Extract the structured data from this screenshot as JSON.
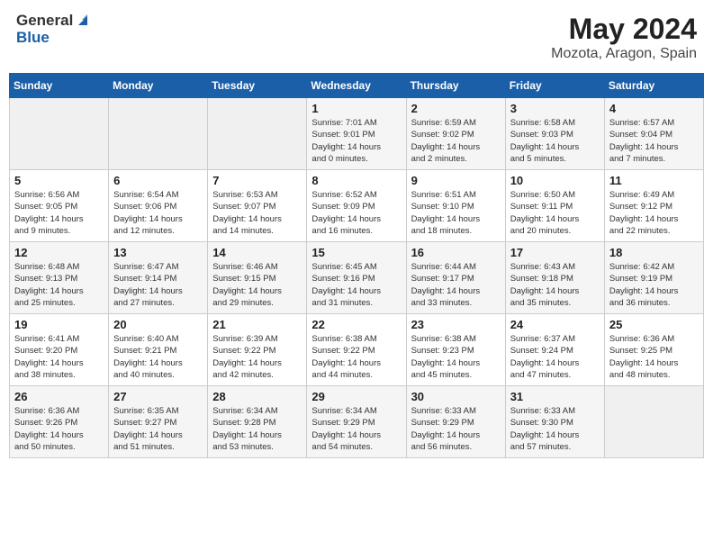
{
  "header": {
    "logo_general": "General",
    "logo_blue": "Blue",
    "month_year": "May 2024",
    "location": "Mozota, Aragon, Spain"
  },
  "days_of_week": [
    "Sunday",
    "Monday",
    "Tuesday",
    "Wednesday",
    "Thursday",
    "Friday",
    "Saturday"
  ],
  "weeks": [
    [
      {
        "day": "",
        "info": ""
      },
      {
        "day": "",
        "info": ""
      },
      {
        "day": "",
        "info": ""
      },
      {
        "day": "1",
        "info": "Sunrise: 7:01 AM\nSunset: 9:01 PM\nDaylight: 14 hours\nand 0 minutes."
      },
      {
        "day": "2",
        "info": "Sunrise: 6:59 AM\nSunset: 9:02 PM\nDaylight: 14 hours\nand 2 minutes."
      },
      {
        "day": "3",
        "info": "Sunrise: 6:58 AM\nSunset: 9:03 PM\nDaylight: 14 hours\nand 5 minutes."
      },
      {
        "day": "4",
        "info": "Sunrise: 6:57 AM\nSunset: 9:04 PM\nDaylight: 14 hours\nand 7 minutes."
      }
    ],
    [
      {
        "day": "5",
        "info": "Sunrise: 6:56 AM\nSunset: 9:05 PM\nDaylight: 14 hours\nand 9 minutes."
      },
      {
        "day": "6",
        "info": "Sunrise: 6:54 AM\nSunset: 9:06 PM\nDaylight: 14 hours\nand 12 minutes."
      },
      {
        "day": "7",
        "info": "Sunrise: 6:53 AM\nSunset: 9:07 PM\nDaylight: 14 hours\nand 14 minutes."
      },
      {
        "day": "8",
        "info": "Sunrise: 6:52 AM\nSunset: 9:09 PM\nDaylight: 14 hours\nand 16 minutes."
      },
      {
        "day": "9",
        "info": "Sunrise: 6:51 AM\nSunset: 9:10 PM\nDaylight: 14 hours\nand 18 minutes."
      },
      {
        "day": "10",
        "info": "Sunrise: 6:50 AM\nSunset: 9:11 PM\nDaylight: 14 hours\nand 20 minutes."
      },
      {
        "day": "11",
        "info": "Sunrise: 6:49 AM\nSunset: 9:12 PM\nDaylight: 14 hours\nand 22 minutes."
      }
    ],
    [
      {
        "day": "12",
        "info": "Sunrise: 6:48 AM\nSunset: 9:13 PM\nDaylight: 14 hours\nand 25 minutes."
      },
      {
        "day": "13",
        "info": "Sunrise: 6:47 AM\nSunset: 9:14 PM\nDaylight: 14 hours\nand 27 minutes."
      },
      {
        "day": "14",
        "info": "Sunrise: 6:46 AM\nSunset: 9:15 PM\nDaylight: 14 hours\nand 29 minutes."
      },
      {
        "day": "15",
        "info": "Sunrise: 6:45 AM\nSunset: 9:16 PM\nDaylight: 14 hours\nand 31 minutes."
      },
      {
        "day": "16",
        "info": "Sunrise: 6:44 AM\nSunset: 9:17 PM\nDaylight: 14 hours\nand 33 minutes."
      },
      {
        "day": "17",
        "info": "Sunrise: 6:43 AM\nSunset: 9:18 PM\nDaylight: 14 hours\nand 35 minutes."
      },
      {
        "day": "18",
        "info": "Sunrise: 6:42 AM\nSunset: 9:19 PM\nDaylight: 14 hours\nand 36 minutes."
      }
    ],
    [
      {
        "day": "19",
        "info": "Sunrise: 6:41 AM\nSunset: 9:20 PM\nDaylight: 14 hours\nand 38 minutes."
      },
      {
        "day": "20",
        "info": "Sunrise: 6:40 AM\nSunset: 9:21 PM\nDaylight: 14 hours\nand 40 minutes."
      },
      {
        "day": "21",
        "info": "Sunrise: 6:39 AM\nSunset: 9:22 PM\nDaylight: 14 hours\nand 42 minutes."
      },
      {
        "day": "22",
        "info": "Sunrise: 6:38 AM\nSunset: 9:22 PM\nDaylight: 14 hours\nand 44 minutes."
      },
      {
        "day": "23",
        "info": "Sunrise: 6:38 AM\nSunset: 9:23 PM\nDaylight: 14 hours\nand 45 minutes."
      },
      {
        "day": "24",
        "info": "Sunrise: 6:37 AM\nSunset: 9:24 PM\nDaylight: 14 hours\nand 47 minutes."
      },
      {
        "day": "25",
        "info": "Sunrise: 6:36 AM\nSunset: 9:25 PM\nDaylight: 14 hours\nand 48 minutes."
      }
    ],
    [
      {
        "day": "26",
        "info": "Sunrise: 6:36 AM\nSunset: 9:26 PM\nDaylight: 14 hours\nand 50 minutes."
      },
      {
        "day": "27",
        "info": "Sunrise: 6:35 AM\nSunset: 9:27 PM\nDaylight: 14 hours\nand 51 minutes."
      },
      {
        "day": "28",
        "info": "Sunrise: 6:34 AM\nSunset: 9:28 PM\nDaylight: 14 hours\nand 53 minutes."
      },
      {
        "day": "29",
        "info": "Sunrise: 6:34 AM\nSunset: 9:29 PM\nDaylight: 14 hours\nand 54 minutes."
      },
      {
        "day": "30",
        "info": "Sunrise: 6:33 AM\nSunset: 9:29 PM\nDaylight: 14 hours\nand 56 minutes."
      },
      {
        "day": "31",
        "info": "Sunrise: 6:33 AM\nSunset: 9:30 PM\nDaylight: 14 hours\nand 57 minutes."
      },
      {
        "day": "",
        "info": ""
      }
    ]
  ]
}
